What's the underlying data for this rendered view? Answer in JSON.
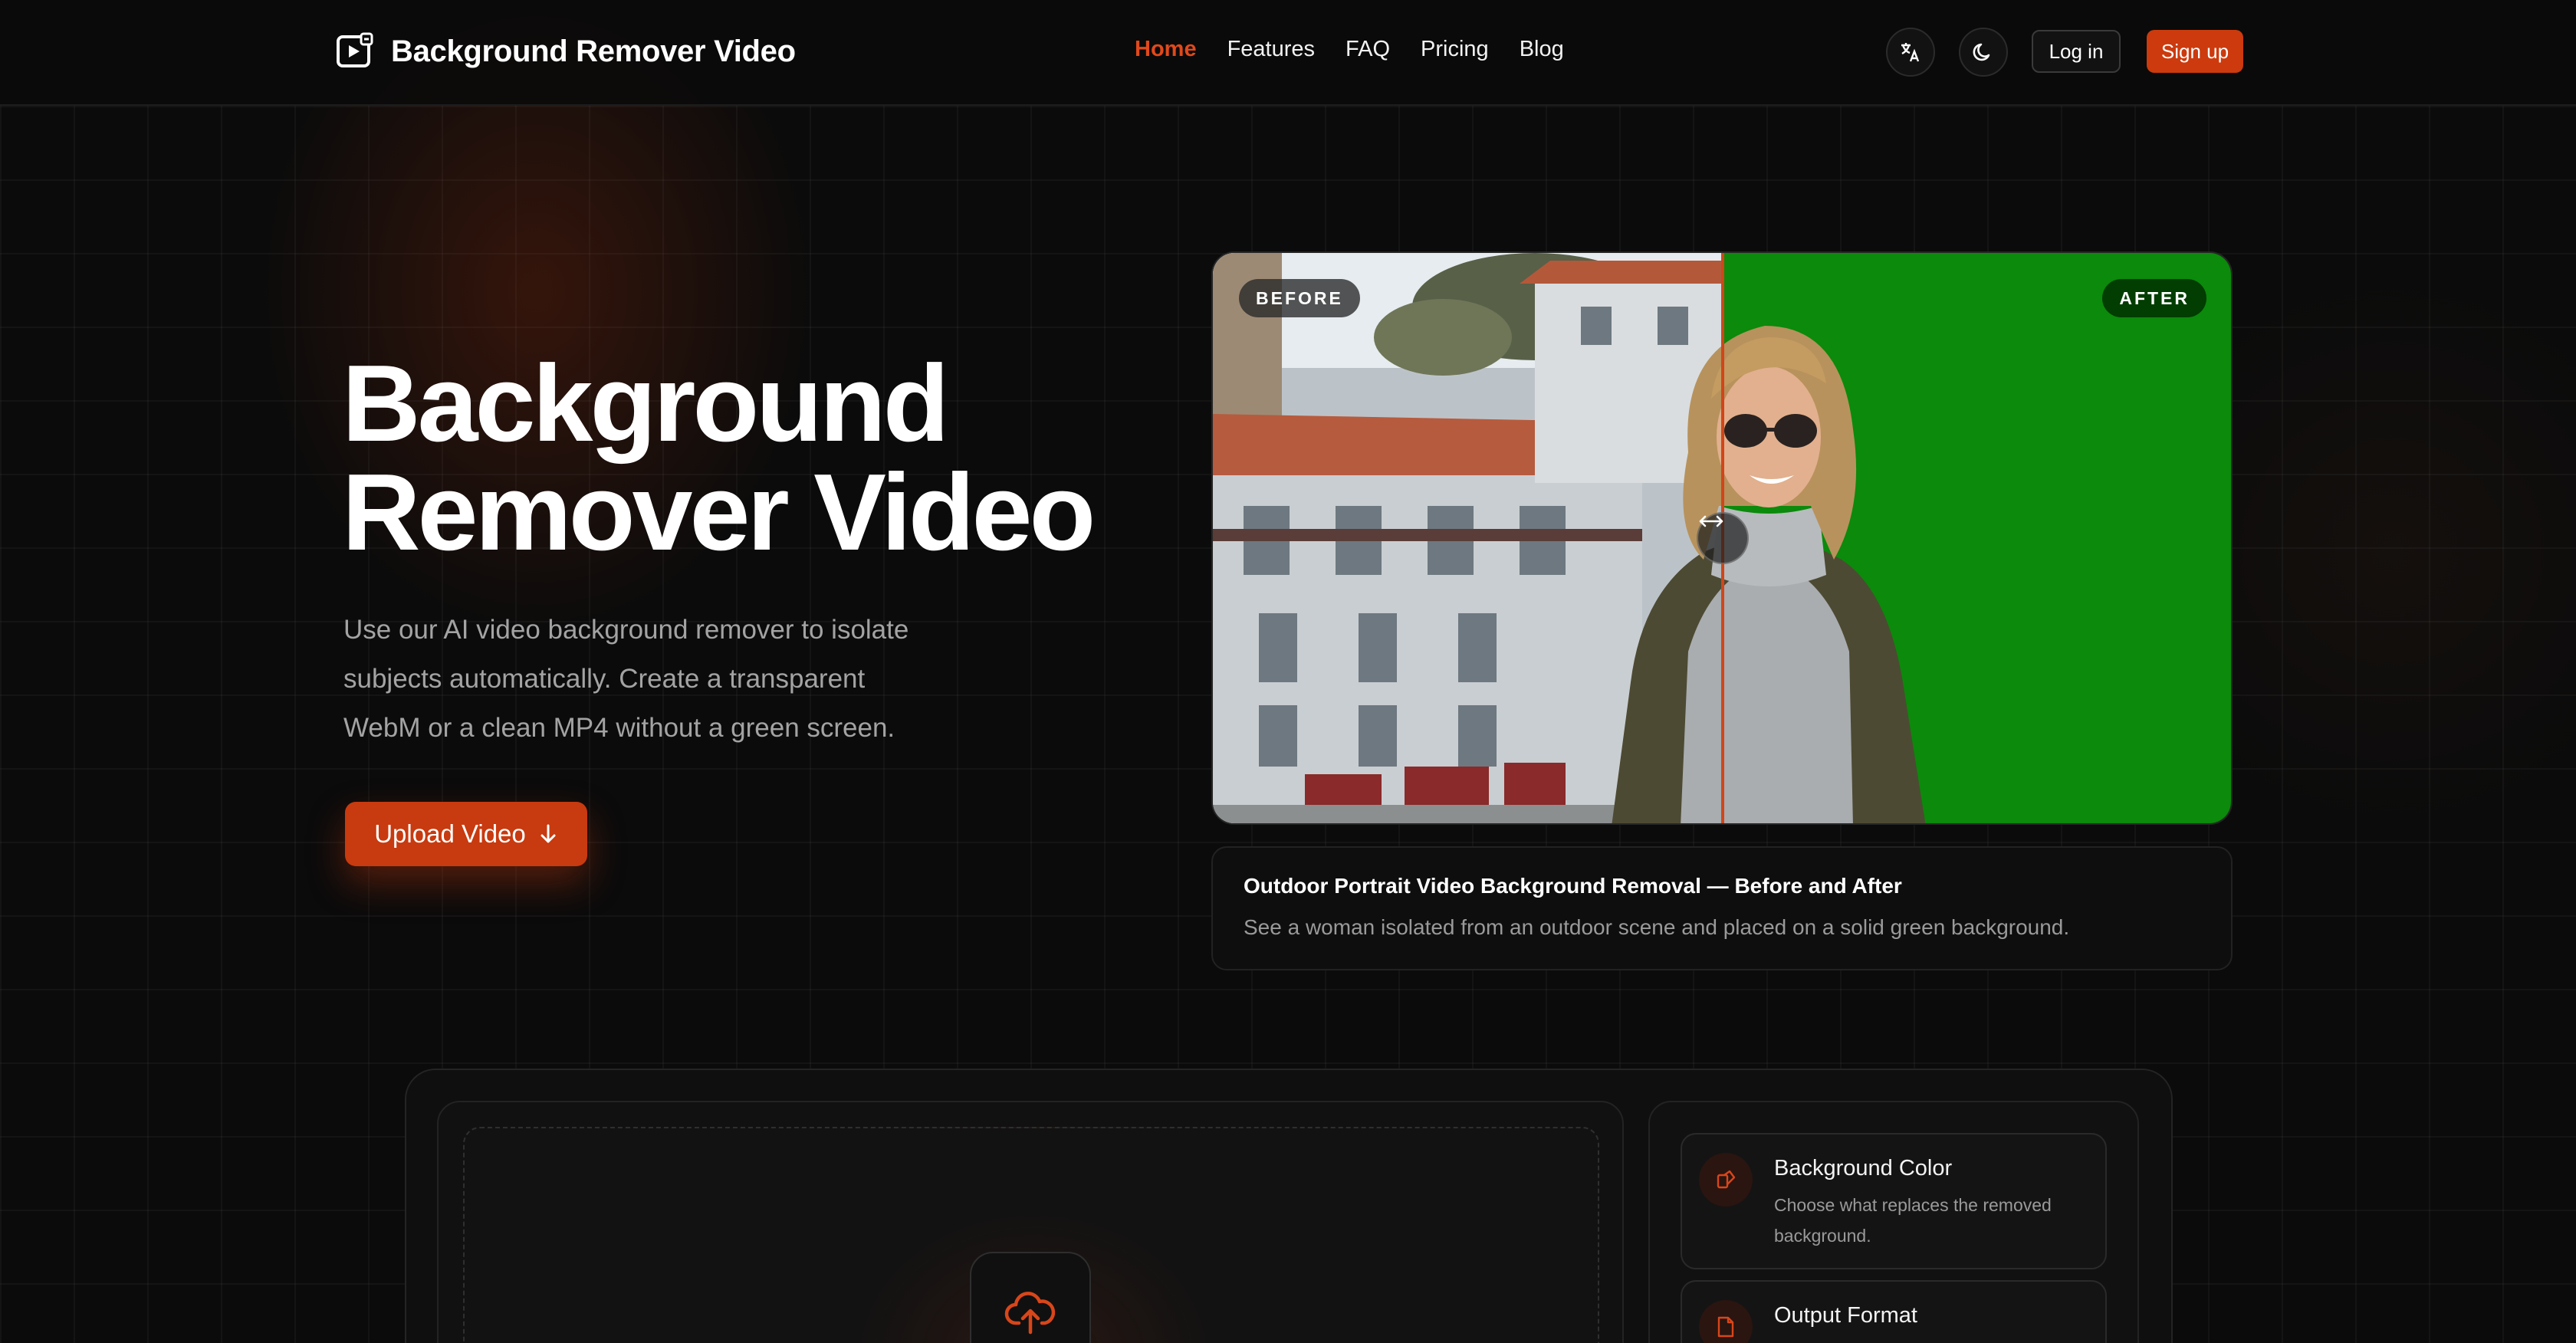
{
  "nav": {
    "brand": "Background Remover Video",
    "links": [
      "Home",
      "Features",
      "FAQ",
      "Pricing",
      "Blog"
    ],
    "active_link": "Home",
    "login_label": "Log in",
    "signup_label": "Sign up"
  },
  "hero": {
    "title_line1": "Background",
    "title_line2": "Remover Video",
    "description": "Use our AI video background remover to isolate subjects automatically. Create a transparent WebM or a clean MP4 without a green screen.",
    "upload_label": "Upload Video"
  },
  "comparison": {
    "before_label": "BEFORE",
    "after_label": "AFTER",
    "caption_title": "Outdoor Portrait Video Background Removal — Before and After",
    "caption_subtitle": "See a woman isolated from an outdoor scene and placed on a solid green background.",
    "replacement_color": "#0b8a0b"
  },
  "tool": {
    "options": [
      {
        "title": "Background Color",
        "description": "Choose what replaces the removed background."
      },
      {
        "title": "Output Format",
        "description": ""
      }
    ]
  },
  "colors": {
    "accent": "#cc3a0d",
    "background": "#0b0b0b"
  },
  "icons": {
    "brand": "play-video-icon",
    "language": "translate-icon",
    "theme": "moon-icon",
    "upload": "arrow-down-icon",
    "slider": "arrows-horizontal-icon",
    "dropzone": "cloud-upload-icon",
    "background_color": "palette-icon",
    "output_format": "file-icon"
  }
}
